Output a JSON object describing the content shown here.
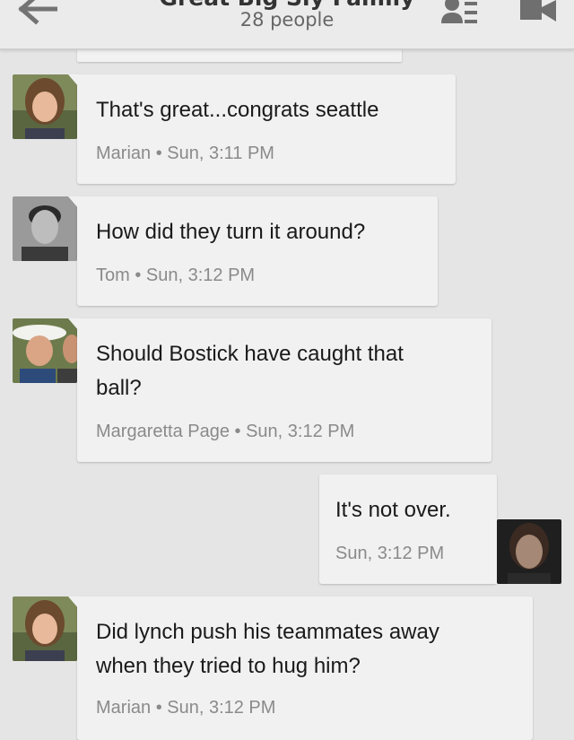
{
  "header": {
    "title": "Great Big Sly Family",
    "subtitle": "28 people",
    "back_icon": "arrow-left-icon",
    "people_icon": "people-list-icon",
    "video_icon": "videocam-icon"
  },
  "messages": [
    {
      "text": "That's great...congrats seattle",
      "meta": "Marian • Sun, 3:11 PM"
    },
    {
      "text": "How did they turn it around?",
      "meta": "Tom • Sun, 3:12 PM"
    },
    {
      "text_line1": "Should Bostick have caught that",
      "text_line2": "ball?",
      "meta": "Margaretta Page • Sun, 3:12 PM"
    },
    {
      "text": "It's not over.",
      "meta": "Sun, 3:12 PM"
    },
    {
      "text_line1": "Did lynch push his teammates away",
      "text_line2": "when they tried to hug him?",
      "meta": "Marian • Sun, 3:12 PM"
    }
  ],
  "colors": {
    "background": "#e5e5e5",
    "bubble": "#f1f1f1",
    "meta_text": "#8a8a8a"
  }
}
